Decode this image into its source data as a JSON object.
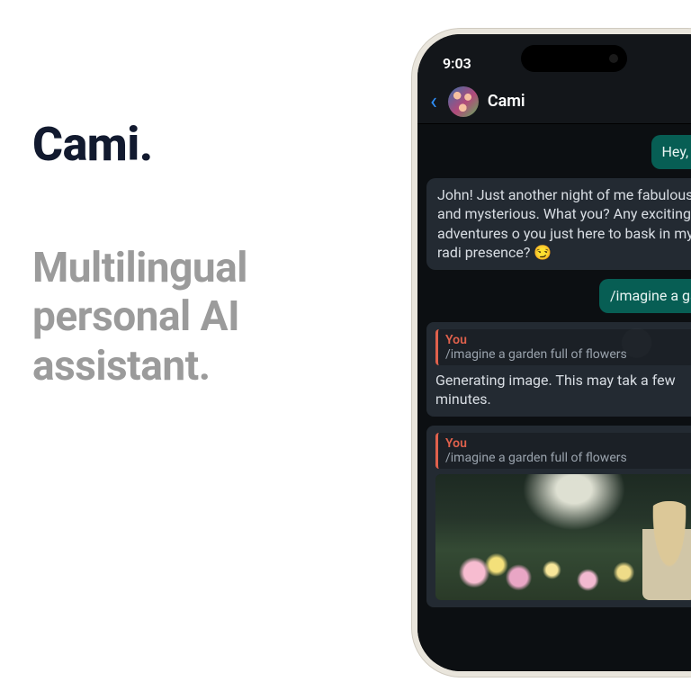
{
  "marketing": {
    "brand": "Cami.",
    "tagline": "Multilingual personal AI assistant."
  },
  "phone": {
    "time": "9:03",
    "contact_name": "Cami",
    "messages": {
      "out1": "Hey, wh",
      "in1": "John! Just another night of me fabulous and mysterious. What you? Any exciting adventures o you just here to bask in my radi presence? 😏",
      "out2": "/imagine a gard",
      "quote1_from": "You",
      "quote1_text": "/imagine a garden full of flowers",
      "quote1_body": "Generating image. This may tak a few minutes.",
      "quote2_from": "You",
      "quote2_text": "/imagine a garden full of flowers"
    }
  }
}
